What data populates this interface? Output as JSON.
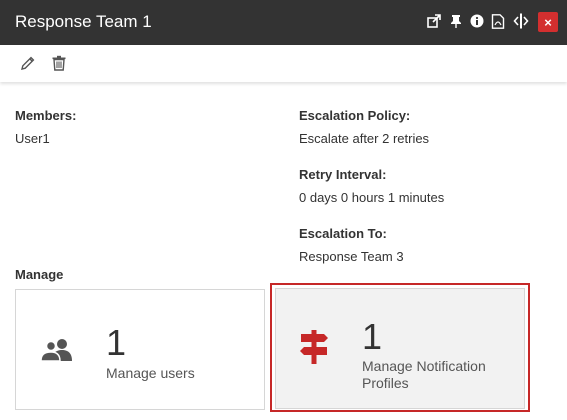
{
  "window": {
    "title": "Response Team 1",
    "close_label": "×"
  },
  "details": {
    "members_label": "Members:",
    "members_value": "User1",
    "policy_label": "Escalation Policy:",
    "policy_value": "Escalate after 2 retries",
    "retry_label": "Retry Interval:",
    "retry_value": "0 days 0 hours 1 minutes",
    "escalation_to_label": "Escalation To:",
    "escalation_to_value": "Response Team 3"
  },
  "manage": {
    "heading": "Manage",
    "cards": [
      {
        "count": "1",
        "label": "Manage users",
        "icon": "users-icon"
      },
      {
        "count": "1",
        "label": "Manage Notification Profiles",
        "icon": "signpost-icon"
      }
    ]
  },
  "colors": {
    "titlebar": "#333333",
    "close": "#d32f2f",
    "accent_red": "#c62828"
  }
}
